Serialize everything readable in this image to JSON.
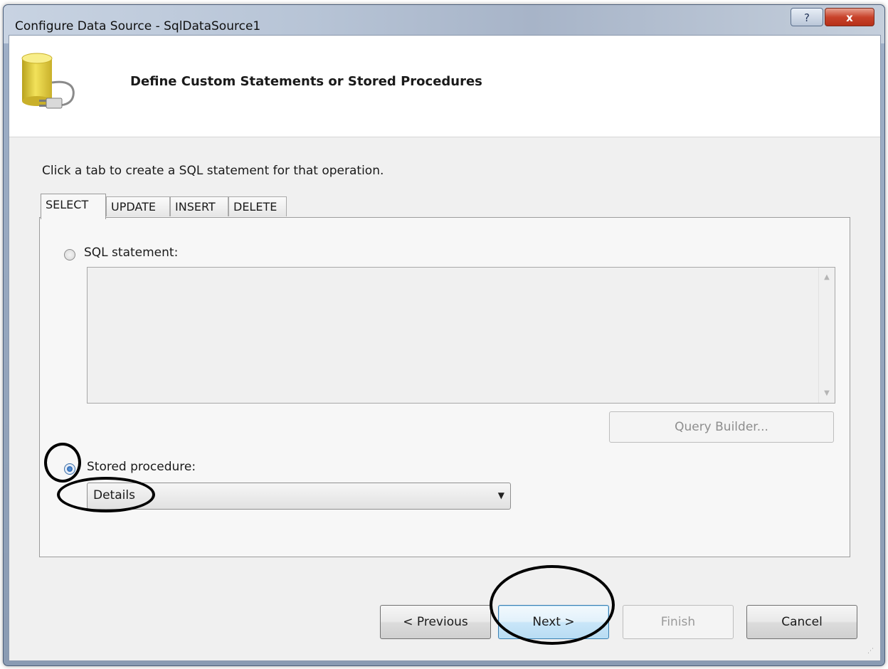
{
  "window": {
    "title": "Configure Data Source - SqlDataSource1",
    "help_label": "?",
    "close_label": "x"
  },
  "header": {
    "title": "Define Custom Statements or Stored Procedures",
    "icon": "database-plug-icon"
  },
  "instruction": "Click a tab to create a SQL statement for that operation.",
  "tabs": [
    {
      "label": "SELECT",
      "active": true
    },
    {
      "label": "UPDATE",
      "active": false
    },
    {
      "label": "INSERT",
      "active": false
    },
    {
      "label": "DELETE",
      "active": false
    }
  ],
  "sql_statement": {
    "label": "SQL statement:",
    "selected": false,
    "value": ""
  },
  "query_builder_label": "Query Builder...",
  "stored_procedure": {
    "label": "Stored procedure:",
    "selected": true,
    "value": "Details"
  },
  "buttons": {
    "previous": "< Previous",
    "next": "Next >",
    "finish": "Finish",
    "cancel": "Cancel"
  },
  "colors": {
    "annotation": "#000000",
    "dialog_bg": "#f0f0f0",
    "default_button_border": "#3c7fb1"
  }
}
